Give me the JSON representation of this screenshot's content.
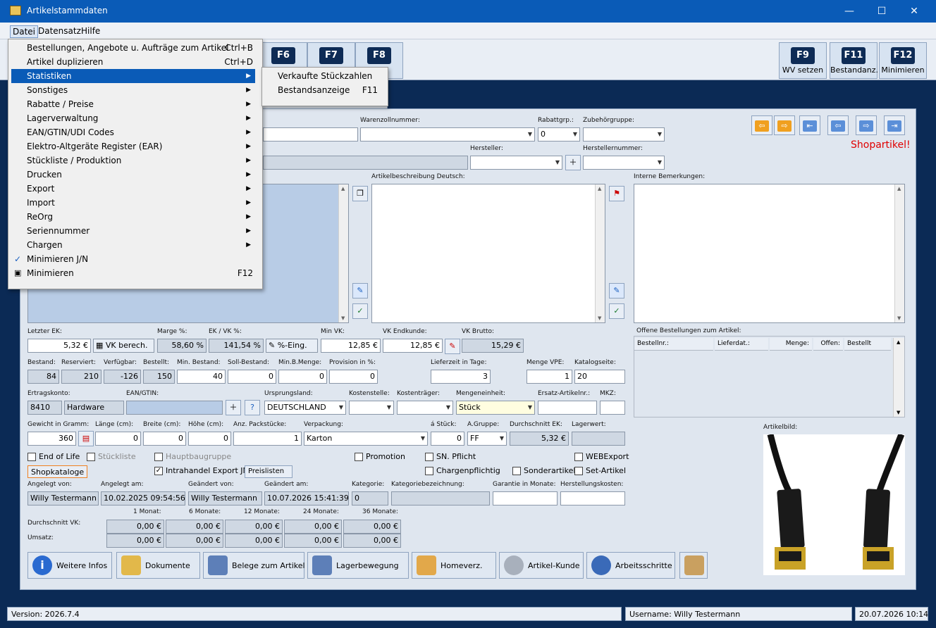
{
  "window": {
    "title": "Artikelstammdaten"
  },
  "menubar": {
    "items": [
      "Datei",
      "Datensatz",
      "Hilfe"
    ]
  },
  "toolbar": {
    "left_keys": [
      {
        "key": "F6",
        "label": ""
      },
      {
        "key": "F7",
        "label": ""
      },
      {
        "key": "F8",
        "label": "e"
      }
    ],
    "right_keys": [
      {
        "key": "F9",
        "label": "WV setzen"
      },
      {
        "key": "F11",
        "label": "Bestandanz."
      },
      {
        "key": "F12",
        "label": "Minimieren"
      }
    ]
  },
  "dropdown": {
    "items": [
      {
        "label": "Bestellungen, Angebote u. Aufträge zum Artikel",
        "shortcut": "Ctrl+B"
      },
      {
        "label": "Artikel duplizieren",
        "shortcut": "Ctrl+D"
      },
      {
        "label": "Statistiken",
        "submenu": true
      },
      {
        "label": "Sonstiges",
        "submenu": true
      },
      {
        "label": "Rabatte / Preise",
        "submenu": true
      },
      {
        "label": "Lagerverwaltung",
        "submenu": true
      },
      {
        "label": "EAN/GTIN/UDI Codes",
        "submenu": true
      },
      {
        "label": "Elektro-Altgeräte Register (EAR)",
        "submenu": true
      },
      {
        "label": "Stückliste / Produktion",
        "submenu": true
      },
      {
        "label": "Drucken",
        "submenu": true
      },
      {
        "label": "Export",
        "submenu": true
      },
      {
        "label": "Import",
        "submenu": true
      },
      {
        "label": "ReOrg",
        "submenu": true
      },
      {
        "label": "Seriennummer",
        "submenu": true
      },
      {
        "label": "Chargen",
        "submenu": true
      },
      {
        "label": "Minimieren J/N",
        "checked": true
      },
      {
        "label": "Minimieren",
        "shortcut": "F12"
      }
    ]
  },
  "submenu": {
    "items": [
      {
        "label": "Verkaufte Stückzahlen",
        "shortcut": ""
      },
      {
        "label": "Bestandsanzeige",
        "shortcut": "F11"
      }
    ]
  },
  "form": {
    "warenzoll_label": "Warenzollnummer:",
    "rabattgrp_label": "Rabattgrp.:",
    "rabattgrp_value": "0",
    "zubehoer_label": "Zubehörgruppe:",
    "hersteller_label": "Hersteller:",
    "herstellernr_label": "Herstellernummer:",
    "shopartikel": "Shopartikel!",
    "beschreibung_label": "Artikelbeschreibung Deutsch:",
    "interne_label": "Interne Bemerkungen:",
    "letzter_ek_label": "Letzter EK:",
    "letzter_ek": "5,32 €",
    "vk_berech": "VK berech.",
    "marge_label": "Marge %:",
    "marge": "58,60 %",
    "ek_vk_label": "EK / VK %:",
    "ek_vk": "141,54 %",
    "prozent_eing": "%-Eing.",
    "min_vk_label": "Min VK:",
    "min_vk": "12,85 €",
    "vk_endkunde_label": "VK Endkunde:",
    "vk_endkunde": "12,85 €",
    "vk_brutto_label": "VK Brutto:",
    "vk_brutto": "15,29 €",
    "bestand_label": "Bestand:",
    "bestand": "84",
    "reserviert_label": "Reserviert:",
    "reserviert": "210",
    "verfuegbar_label": "Verfügbar:",
    "verfuegbar": "-126",
    "bestellt_label": "Bestellt:",
    "bestellt": "150",
    "min_bestand_label": "Min. Bestand:",
    "min_bestand": "40",
    "soll_bestand_label": "Soll-Bestand:",
    "soll_bestand": "0",
    "min_b_menge_label": "Min.B.Menge:",
    "min_b_menge": "0",
    "provision_label": "Provision in %:",
    "provision": "0",
    "lieferzeit_label": "Lieferzeit in Tage:",
    "lieferzeit": "3",
    "menge_vpe_label": "Menge VPE:",
    "menge_vpe": "1",
    "katalogseite_label": "Katalogseite:",
    "katalogseite": "20",
    "ertragskonto_label": "Ertragskonto:",
    "ertragskonto": "8410",
    "ertragskonto_name": "Hardware",
    "ean_label": "EAN/GTIN:",
    "ursprungsland_label": "Ursprungsland:",
    "ursprungsland": "DEUTSCHLAND",
    "kostenstelle_label": "Kostenstelle:",
    "kostentraeger_label": "Kostenträger:",
    "mengeneinheit_label": "Mengeneinheit:",
    "mengeneinheit": "Stück",
    "ersatz_label": "Ersatz-Artikelnr.:",
    "mkz_label": "MKZ:",
    "gewicht_label": "Gewicht in Gramm:",
    "gewicht": "360",
    "laenge_label": "Länge (cm):",
    "laenge": "0",
    "breite_label": "Breite (cm):",
    "breite": "0",
    "hoehe_label": "Höhe (cm):",
    "hoehe": "0",
    "packstuecke_label": "Anz. Packstücke:",
    "packstuecke": "1",
    "verpackung_label": "Verpackung:",
    "verpackung": "Karton",
    "a_stueck_label": "á Stück:",
    "a_stueck": "0",
    "a_gruppe_label": "A.Gruppe:",
    "a_gruppe": "FF",
    "durchschnitt_ek_label": "Durchschnitt EK:",
    "durchschnitt_ek": "5,32 €",
    "lagerwert_label": "Lagerwert:",
    "offene_label": "Offene Bestellungen zum Artikel:",
    "offene_cols": [
      "Bestellnr.:",
      "Lieferdat.:",
      "Menge:",
      "Offen:",
      "Bestellt"
    ],
    "artikelbild_label": "Artikelbild:",
    "checkboxes": {
      "end_of_life": "End of Life",
      "stueckliste": "Stückliste",
      "hauptbaugruppe": "Hauptbaugruppe",
      "promotion": "Promotion",
      "sn_pflicht": "SN. Pflicht",
      "webexport": "WEBExport",
      "intrahandel": "Intrahandel Export JN",
      "chargenpflichtig": "Chargenpflichtig",
      "sonderartikel": "Sonderartikel",
      "set_artikel": "Set-Artikel"
    },
    "shopkataloge": "Shopkataloge",
    "preislisten": "Preislisten",
    "angelegt_von_label": "Angelegt von:",
    "angelegt_von": "Willy Testermann",
    "angelegt_am_label": "Angelegt am:",
    "angelegt_am": "10.02.2025 09:54:56",
    "geaendert_von_label": "Geändert von:",
    "geaendert_von": "Willy Testermann",
    "geaendert_am_label": "Geändert am:",
    "geaendert_am": "10.07.2026 15:41:39",
    "kategorie_label": "Kategorie:",
    "kategorie": "0",
    "kategoriebez_label": "Kategoriebezeichnung:",
    "garantie_label": "Garantie in Monate:",
    "herstellkosten_label": "Herstellungskosten:",
    "monate_headers": [
      "1 Monat:",
      "6 Monate:",
      "12 Monate:",
      "24 Monate:",
      "36 Monate:"
    ],
    "durchschnitt_vk_label": "Durchschnitt VK:",
    "umsatz_label": "Umsatz:",
    "durchschnitt_vk_values": [
      "0,00 €",
      "0,00 €",
      "0,00 €",
      "0,00 €",
      "0,00 €"
    ],
    "umsatz_values": [
      "0,00 €",
      "0,00 €",
      "0,00 €",
      "0,00 €",
      "0,00 €"
    ]
  },
  "bottom_buttons": [
    "Weitere Infos",
    "Dokumente",
    "Belege zum Artikel",
    "Lagerbewegung",
    "Homeverz.",
    "Artikel-Kunde",
    "Arbeitsschritte"
  ],
  "status": {
    "version": "Version: 2026.7.4",
    "username": "Username: Willy Testermann",
    "datetime": "20.07.2026 10:14"
  },
  "colors": {
    "titlebar": "#0a5bb7",
    "background": "#0b2a55",
    "panel": "#dfe6ef",
    "highlight": "#0a5bb7",
    "shopartikel": "#e00000",
    "nav_orange": "#f0a020",
    "nav_blue": "#5b8fd8"
  }
}
